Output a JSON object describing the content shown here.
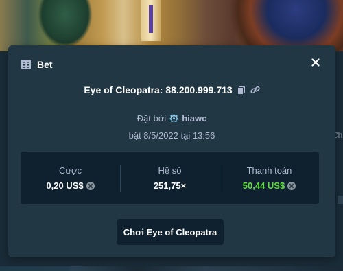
{
  "modal": {
    "title": "Bet",
    "title_icon": "bet-slip-icon",
    "close_icon": "close-icon"
  },
  "bet": {
    "game_line": "Eye of Cleopatra: 88.200.999.713",
    "placed_by_label": "Đặt bởi",
    "user": "hiawc",
    "user_icon": "crown-icon",
    "date_line": "bật 8/5/2022 tại 13:56"
  },
  "stats": {
    "wager_label": "Cược",
    "wager_value": "0,20 US$",
    "multiplier_label": "Hệ số",
    "multiplier_value": "251,75×",
    "payout_label": "Thanh toán",
    "payout_value": "50,44 US$"
  },
  "actions": {
    "play_label": "Chơi Eye of Cleopatra"
  },
  "background": {
    "side_text": "Ch"
  },
  "colors": {
    "modal_bg": "#213743",
    "panel_bg": "#0f212e",
    "payout_green": "#5ddc3c",
    "muted_text": "#b1bad3"
  }
}
